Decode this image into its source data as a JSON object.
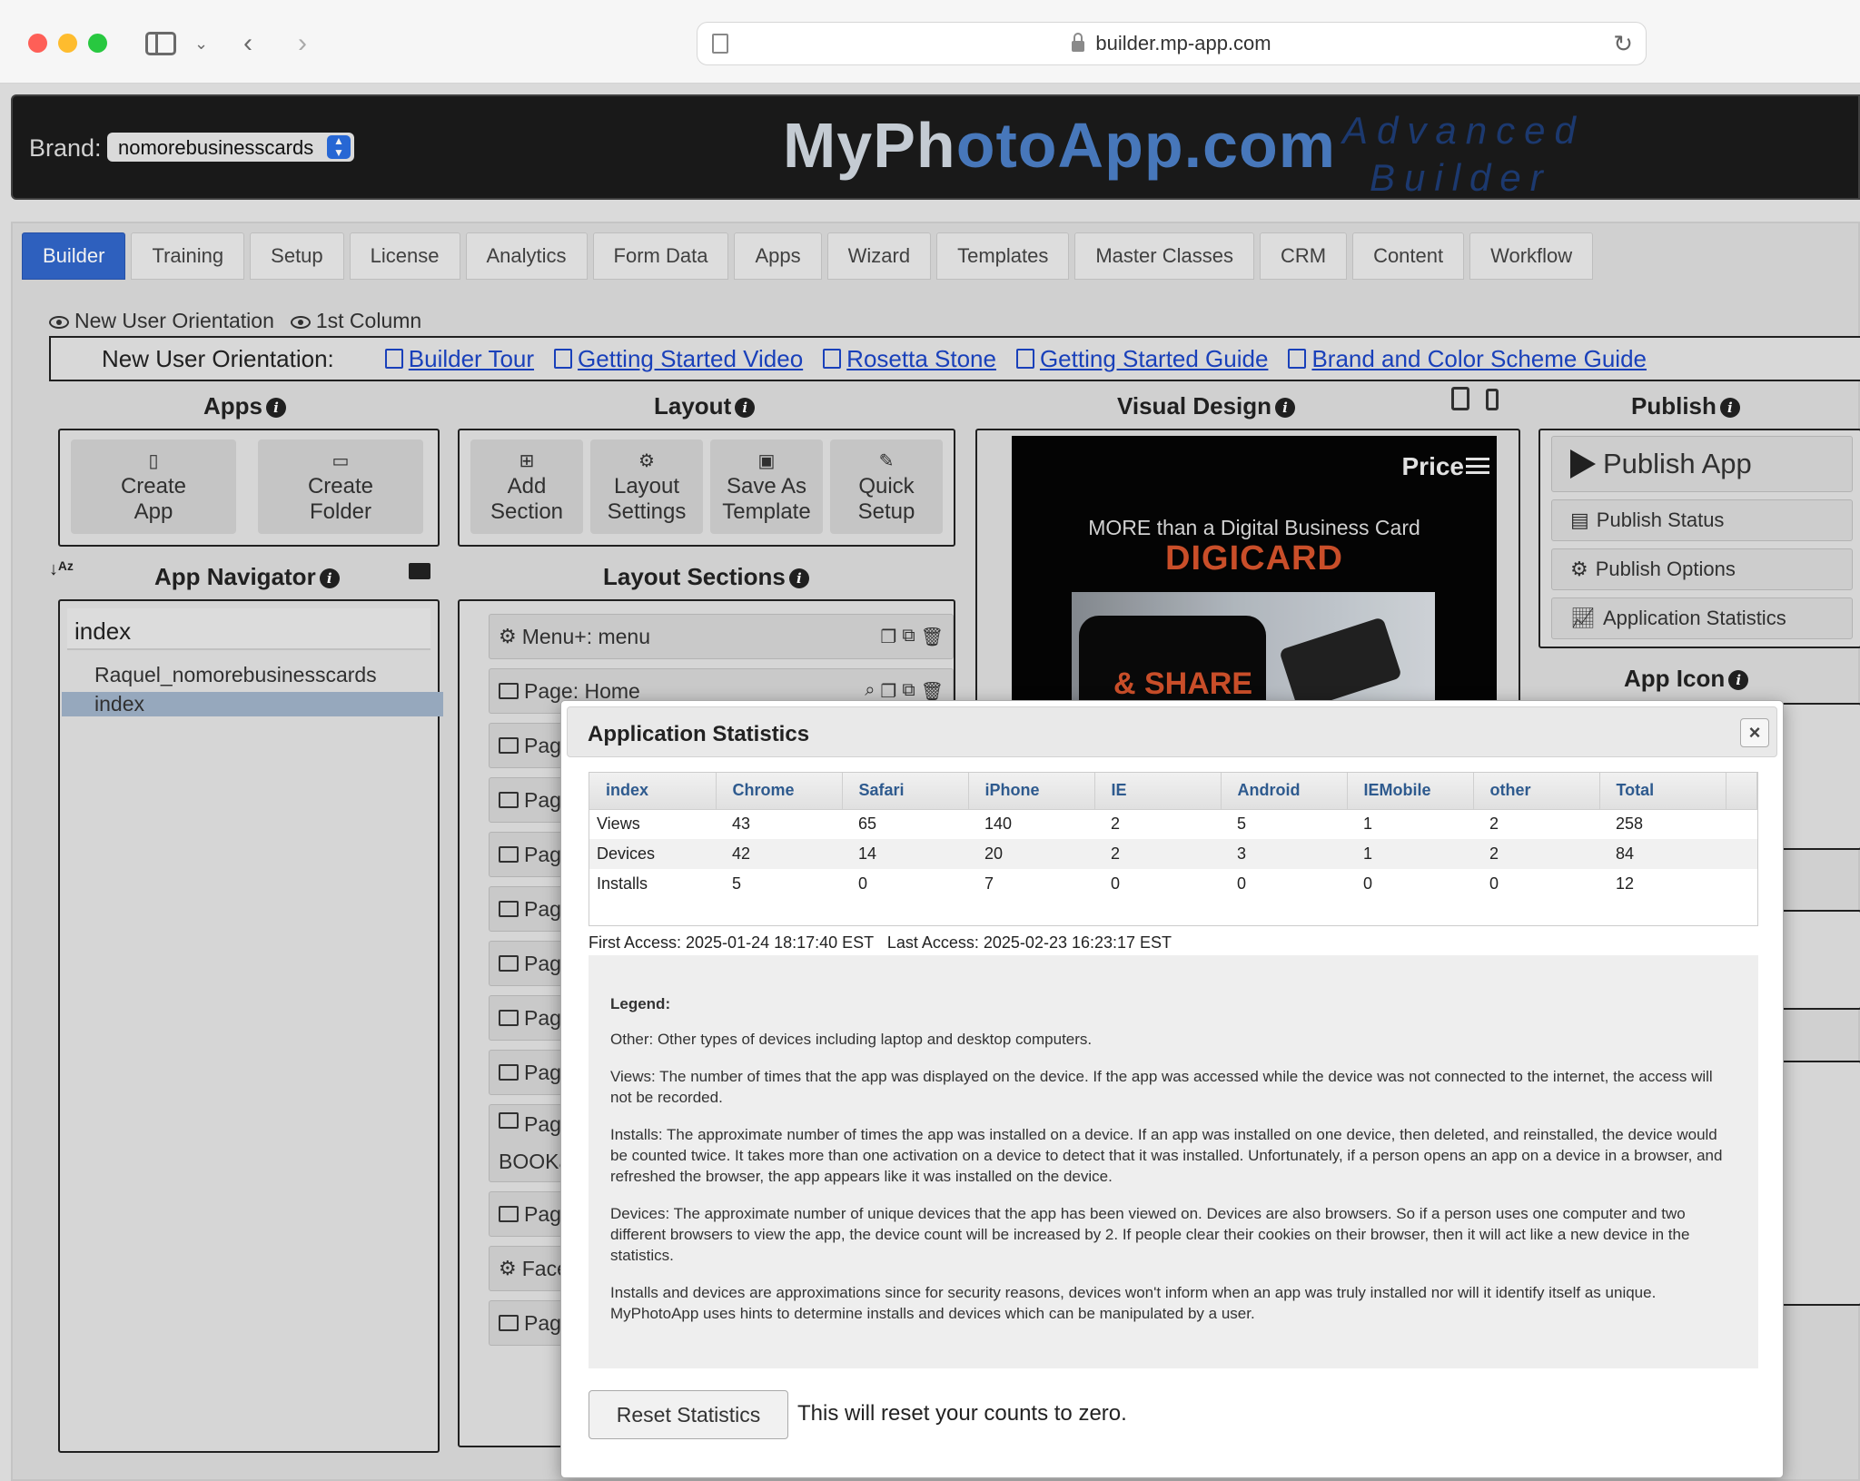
{
  "browser": {
    "url": "builder.mp-app.com"
  },
  "header": {
    "brand_label": "Brand:",
    "brand_value": "nomorebusinesscards",
    "logo_text_a": "MyPh",
    "logo_text_b": "o",
    "logo_text_c": "toApp",
    "logo_text_d": ".com",
    "logo_sub_1": "Advanced",
    "logo_sub_2": "Builder"
  },
  "tabs": [
    "Builder",
    "Training",
    "Setup",
    "License",
    "Analytics",
    "Form Data",
    "Apps",
    "Wizard",
    "Templates",
    "Master Classes",
    "CRM",
    "Content",
    "Workflow"
  ],
  "toggles": {
    "orientation": "New User Orientation",
    "first_column": "1st Column"
  },
  "orientation": {
    "label": "New User Orientation:",
    "links": [
      "Builder Tour",
      "Getting Started Video",
      "Rosetta Stone",
      "Getting Started Guide",
      "Brand and Color Scheme Guide"
    ]
  },
  "columns": {
    "apps": "Apps",
    "layout": "Layout",
    "visual": "Visual Design",
    "publish": "Publish",
    "navigator": "App Navigator",
    "sections": "Layout Sections",
    "app_icon": "App Icon"
  },
  "apps_tools": {
    "create_app_1": "Create",
    "create_app_2": "App",
    "create_folder_1": "Create",
    "create_folder_2": "Folder"
  },
  "layout_tools": {
    "add_1": "Add",
    "add_2": "Section",
    "settings_1": "Layout",
    "settings_2": "Settings",
    "save_1": "Save As",
    "save_2": "Template",
    "quick_1": "Quick",
    "quick_2": "Setup"
  },
  "navigator": {
    "search": "index",
    "items": [
      "Raquel_nomorebusinesscards",
      "index"
    ]
  },
  "sections": [
    "Menu+: menu",
    "Page: Home",
    "Page",
    "Page",
    "Page",
    "Page",
    "Page",
    "Page",
    "Page",
    "Page",
    "BOOKa",
    "Page",
    "Faceb",
    "Page"
  ],
  "preview": {
    "price": "Price",
    "tagline": "MORE than a Digital Business Card",
    "title": "DIGICARD",
    "share": "& SHARE"
  },
  "publish": {
    "publish_app": "Publish App",
    "status": "Publish Status",
    "options": "Publish Options",
    "stats": "Application Statistics"
  },
  "modal": {
    "title": "Application Statistics",
    "close": "×",
    "columns": [
      "index",
      "Chrome",
      "Safari",
      "iPhone",
      "IE",
      "Android",
      "IEMobile",
      "other",
      "Total"
    ],
    "rows": [
      [
        "Views",
        "43",
        "65",
        "140",
        "2",
        "5",
        "1",
        "2",
        "258"
      ],
      [
        "Devices",
        "42",
        "14",
        "20",
        "2",
        "3",
        "1",
        "2",
        "84"
      ],
      [
        "Installs",
        "5",
        "0",
        "7",
        "0",
        "0",
        "0",
        "0",
        "12"
      ]
    ],
    "access": "First Access: 2025-01-24 18:17:40 EST   Last Access: 2025-02-23 16:23:17 EST",
    "legend_title": "Legend:",
    "legend": [
      "Other: Other types of devices including laptop and desktop computers.",
      "Views: The number of times that the app was displayed on the device. If the app was accessed while the device was not connected to the internet, the access will not be recorded.",
      "Installs: The approximate number of times the app was installed on a device. If an app was installed on one device, then deleted, and reinstalled, the device would be counted twice. It takes more than one activation on a device to detect that it was installed. Unfortunately, if a person opens an app on a device in a browser, and refreshed the browser, the app appears like it was installed on the device.",
      "Devices: The approximate number of unique devices that the app has been viewed on. Devices are also browsers. So if a person uses one computer and two different browsers to view the app, the device count will be increased by 2. If people clear their cookies on their browser, then it will act like a new device in the statistics.",
      "Installs and devices are approximations since for security reasons, devices won't inform when an app was truly installed nor will it identify itself as unique. MyPhotoApp uses hints to determine installs and devices which can be manipulated by a user."
    ],
    "reset_button": "Reset Statistics",
    "reset_note": "This will reset your counts to zero."
  }
}
